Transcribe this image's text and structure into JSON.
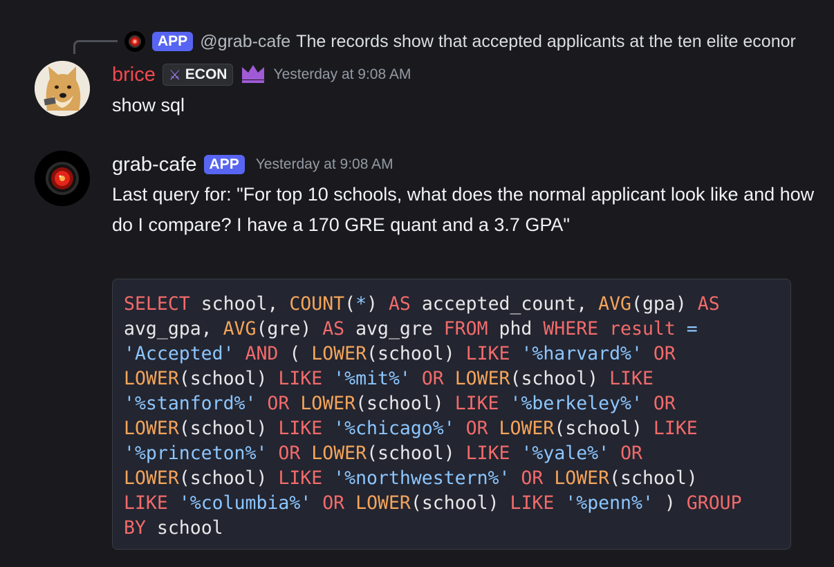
{
  "reply": {
    "app_tag": "APP",
    "author": "@grab-cafe",
    "text": "The records show that accepted applicants at the ten elite econor"
  },
  "message1": {
    "username": "brice",
    "role": "ECON",
    "timestamp": "Yesterday at 9:08 AM",
    "text": "show sql",
    "icons": [
      "sword-icon",
      "crown-icon"
    ]
  },
  "message2": {
    "username": "grab-cafe",
    "app_tag": "APP",
    "timestamp": "Yesterday at 9:08 AM",
    "text": "Last query for: \"For top 10 schools, what does the normal applicant look like and how do I compare? I have a 170 GRE quant and a 3.7 GPA\""
  },
  "code": {
    "lines": [
      [
        [
          "kw",
          "SELECT"
        ],
        [
          "t",
          " school, "
        ],
        [
          "fn",
          "COUNT"
        ],
        [
          "t",
          "("
        ],
        [
          "op",
          "*"
        ],
        [
          "t",
          ") "
        ],
        [
          "kw",
          "AS"
        ],
        [
          "t",
          " accepted_count, "
        ],
        [
          "fn",
          "AVG"
        ],
        [
          "t",
          "(gpa) "
        ],
        [
          "kw",
          "AS"
        ]
      ],
      [
        [
          "t",
          "avg_gpa, "
        ],
        [
          "fn",
          "AVG"
        ],
        [
          "t",
          "(gre) "
        ],
        [
          "kw",
          "AS"
        ],
        [
          "t",
          " avg_gre "
        ],
        [
          "kw",
          "FROM"
        ],
        [
          "t",
          " phd "
        ],
        [
          "kw",
          "WHERE"
        ],
        [
          "t",
          " "
        ],
        [
          "kw",
          "result"
        ],
        [
          "t",
          " "
        ],
        [
          "op",
          "="
        ]
      ],
      [
        [
          "str",
          "'Accepted'"
        ],
        [
          "t",
          " "
        ],
        [
          "kw",
          "AND"
        ],
        [
          "t",
          " ( "
        ],
        [
          "fn",
          "LOWER"
        ],
        [
          "t",
          "(school) "
        ],
        [
          "kw",
          "LIKE"
        ],
        [
          "t",
          " "
        ],
        [
          "str",
          "'%harvard%'"
        ],
        [
          "t",
          " "
        ],
        [
          "kw",
          "OR"
        ]
      ],
      [
        [
          "fn",
          "LOWER"
        ],
        [
          "t",
          "(school) "
        ],
        [
          "kw",
          "LIKE"
        ],
        [
          "t",
          " "
        ],
        [
          "str",
          "'%mit%'"
        ],
        [
          "t",
          " "
        ],
        [
          "kw",
          "OR"
        ],
        [
          "t",
          " "
        ],
        [
          "fn",
          "LOWER"
        ],
        [
          "t",
          "(school) "
        ],
        [
          "kw",
          "LIKE"
        ]
      ],
      [
        [
          "str",
          "'%stanford%'"
        ],
        [
          "t",
          " "
        ],
        [
          "kw",
          "OR"
        ],
        [
          "t",
          " "
        ],
        [
          "fn",
          "LOWER"
        ],
        [
          "t",
          "(school) "
        ],
        [
          "kw",
          "LIKE"
        ],
        [
          "t",
          " "
        ],
        [
          "str",
          "'%berkeley%'"
        ],
        [
          "t",
          " "
        ],
        [
          "kw",
          "OR"
        ]
      ],
      [
        [
          "fn",
          "LOWER"
        ],
        [
          "t",
          "(school) "
        ],
        [
          "kw",
          "LIKE"
        ],
        [
          "t",
          " "
        ],
        [
          "str",
          "'%chicago%'"
        ],
        [
          "t",
          " "
        ],
        [
          "kw",
          "OR"
        ],
        [
          "t",
          " "
        ],
        [
          "fn",
          "LOWER"
        ],
        [
          "t",
          "(school) "
        ],
        [
          "kw",
          "LIKE"
        ]
      ],
      [
        [
          "str",
          "'%princeton%'"
        ],
        [
          "t",
          " "
        ],
        [
          "kw",
          "OR"
        ],
        [
          "t",
          " "
        ],
        [
          "fn",
          "LOWER"
        ],
        [
          "t",
          "(school) "
        ],
        [
          "kw",
          "LIKE"
        ],
        [
          "t",
          " "
        ],
        [
          "str",
          "'%yale%'"
        ],
        [
          "t",
          " "
        ],
        [
          "kw",
          "OR"
        ]
      ],
      [
        [
          "fn",
          "LOWER"
        ],
        [
          "t",
          "(school) "
        ],
        [
          "kw",
          "LIKE"
        ],
        [
          "t",
          " "
        ],
        [
          "str",
          "'%northwestern%'"
        ],
        [
          "t",
          " "
        ],
        [
          "kw",
          "OR"
        ],
        [
          "t",
          " "
        ],
        [
          "fn",
          "LOWER"
        ],
        [
          "t",
          "(school)"
        ]
      ],
      [
        [
          "kw",
          "LIKE"
        ],
        [
          "t",
          " "
        ],
        [
          "str",
          "'%columbia%'"
        ],
        [
          "t",
          " "
        ],
        [
          "kw",
          "OR"
        ],
        [
          "t",
          " "
        ],
        [
          "fn",
          "LOWER"
        ],
        [
          "t",
          "(school) "
        ],
        [
          "kw",
          "LIKE"
        ],
        [
          "t",
          " "
        ],
        [
          "str",
          "'%penn%'"
        ],
        [
          "t",
          " ) "
        ],
        [
          "kw",
          "GROUP"
        ]
      ],
      [
        [
          "kw",
          "BY"
        ],
        [
          "t",
          " school"
        ]
      ]
    ]
  }
}
